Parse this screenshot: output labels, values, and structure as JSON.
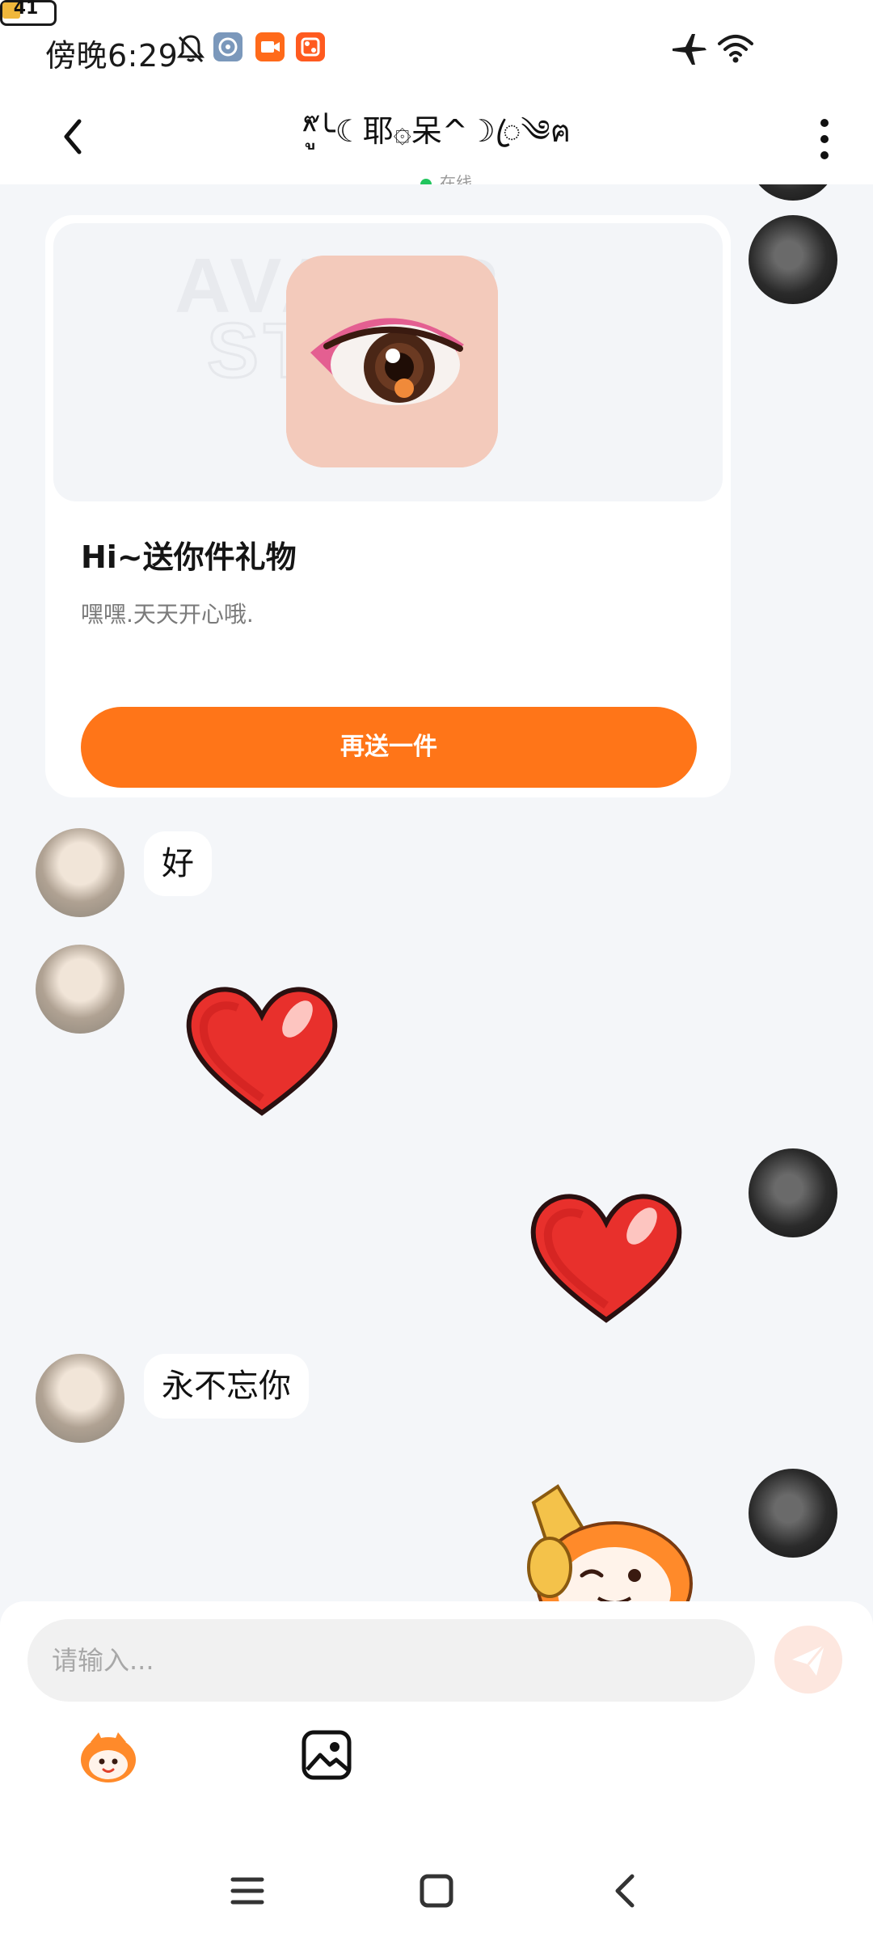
{
  "status_bar": {
    "time": "傍晚6:29",
    "battery": "41",
    "icons": [
      "bell-muted-icon",
      "app-notification-icon",
      "video-app-icon",
      "video-app-icon-2",
      "airplane-mode-icon",
      "wifi-icon",
      "battery-icon"
    ]
  },
  "header": {
    "title": "^ู๊╰☾耶۞呆^☽ꦿ༄ฅ",
    "status": "在线",
    "back_icon": "chevron-left-icon",
    "more_icon": "more-vertical-icon"
  },
  "gift_card": {
    "watermark": "AVATAR STORE",
    "title": "Hi~送你件礼物",
    "description": "嘿嘿.天天开心哦.",
    "button": "再送一件"
  },
  "messages": [
    {
      "side": "left",
      "type": "text",
      "text": "好"
    },
    {
      "side": "left",
      "type": "sticker",
      "sticker": "red-heart"
    },
    {
      "side": "right",
      "type": "sticker",
      "sticker": "red-heart"
    },
    {
      "side": "left",
      "type": "text",
      "text": "永不忘你"
    },
    {
      "side": "right",
      "type": "sticker",
      "sticker": "mascot-wink-thumb"
    }
  ],
  "input": {
    "placeholder": "请输入...",
    "send_icon": "send-paper-plane-icon"
  },
  "toolbar": {
    "items": [
      "mascot-emoji-icon",
      "image-gallery-icon"
    ]
  },
  "nav_bar": {
    "items": [
      "menu-icon",
      "home-square-icon",
      "back-icon"
    ]
  },
  "colors": {
    "accent": "#ff7518",
    "chat_background": "#f4f6f9",
    "online": "#22c55e"
  }
}
